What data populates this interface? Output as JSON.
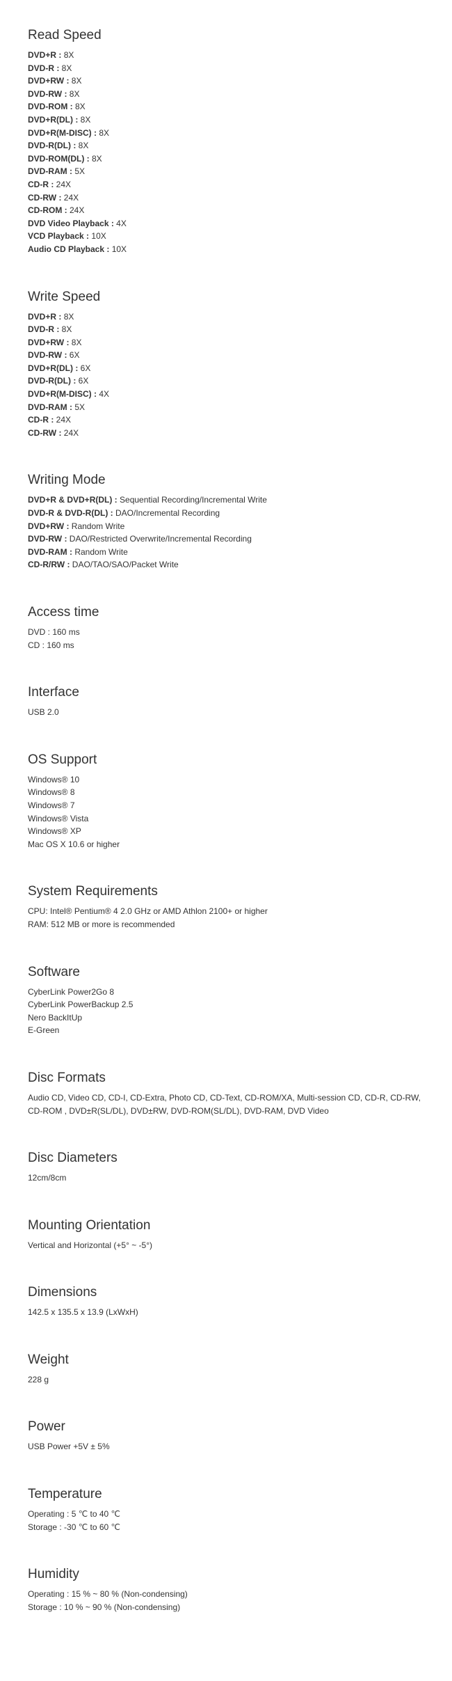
{
  "sections": [
    {
      "title": "Read Speed",
      "type": "labeled",
      "items": [
        {
          "label": "DVD+R",
          "value": "8X"
        },
        {
          "label": "DVD-R",
          "value": "8X"
        },
        {
          "label": "DVD+RW",
          "value": "8X"
        },
        {
          "label": "DVD-RW",
          "value": "8X"
        },
        {
          "label": "DVD-ROM",
          "value": "8X"
        },
        {
          "label": "DVD+R(DL)",
          "value": "8X"
        },
        {
          "label": "DVD+R(M-DISC)",
          "value": "8X"
        },
        {
          "label": "DVD-R(DL)",
          "value": "8X"
        },
        {
          "label": "DVD-ROM(DL)",
          "value": "8X"
        },
        {
          "label": "DVD-RAM",
          "value": "5X"
        },
        {
          "label": "CD-R",
          "value": "24X"
        },
        {
          "label": "CD-RW",
          "value": "24X"
        },
        {
          "label": "CD-ROM",
          "value": "24X"
        },
        {
          "label": "DVD Video Playback",
          "value": "4X"
        },
        {
          "label": "VCD Playback",
          "value": "10X"
        },
        {
          "label": "Audio CD Playback",
          "value": "10X"
        }
      ]
    },
    {
      "title": "Write Speed",
      "type": "labeled",
      "items": [
        {
          "label": "DVD+R",
          "value": "8X"
        },
        {
          "label": "DVD-R",
          "value": "8X"
        },
        {
          "label": "DVD+RW",
          "value": "8X"
        },
        {
          "label": "DVD-RW",
          "value": "6X"
        },
        {
          "label": "DVD+R(DL)",
          "value": "6X"
        },
        {
          "label": "DVD-R(DL)",
          "value": "6X"
        },
        {
          "label": "DVD+R(M-DISC)",
          "value": "4X"
        },
        {
          "label": "DVD-RAM",
          "value": "5X"
        },
        {
          "label": "CD-R",
          "value": "24X"
        },
        {
          "label": "CD-RW",
          "value": "24X"
        }
      ]
    },
    {
      "title": "Writing Mode",
      "type": "labeled",
      "items": [
        {
          "label": "DVD+R & DVD+R(DL)",
          "value": "Sequential Recording/Incremental Write"
        },
        {
          "label": "DVD-R & DVD-R(DL)",
          "value": "DAO/Incremental Recording"
        },
        {
          "label": "DVD+RW",
          "value": "Random Write"
        },
        {
          "label": "DVD-RW",
          "value": "DAO/Restricted Overwrite/Incremental Recording"
        },
        {
          "label": "DVD-RAM",
          "value": "Random Write"
        },
        {
          "label": "CD-R/RW",
          "value": "DAO/TAO/SAO/Packet Write"
        }
      ]
    },
    {
      "title": "Access time",
      "type": "plain",
      "lines": [
        "DVD : 160 ms",
        "CD : 160 ms"
      ]
    },
    {
      "title": "Interface",
      "type": "plain",
      "lines": [
        "USB 2.0"
      ]
    },
    {
      "title": "OS Support",
      "type": "plain",
      "lines": [
        "Windows® 10",
        "Windows® 8",
        "Windows® 7",
        "Windows® Vista",
        "Windows® XP",
        "Mac OS X 10.6 or higher"
      ]
    },
    {
      "title": "System Requirements",
      "type": "plain",
      "lines": [
        "CPU: Intel® Pentium® 4 2.0 GHz or AMD Athlon 2100+ or higher",
        "RAM: 512 MB or more is recommended"
      ]
    },
    {
      "title": "Software",
      "type": "plain",
      "lines": [
        "CyberLink Power2Go 8",
        "CyberLink PowerBackup 2.5",
        "Nero BackItUp",
        "E-Green"
      ]
    },
    {
      "title": "Disc Formats",
      "type": "plain",
      "lines": [
        "Audio CD, Video CD, CD-I, CD-Extra, Photo CD, CD-Text, CD-ROM/XA, Multi-session CD, CD-R, CD-RW, CD-ROM , DVD±R(SL/DL), DVD±RW, DVD-ROM(SL/DL), DVD-RAM, DVD Video"
      ]
    },
    {
      "title": "Disc Diameters",
      "type": "plain",
      "lines": [
        "12cm/8cm"
      ]
    },
    {
      "title": "Mounting Orientation",
      "type": "plain",
      "lines": [
        "Vertical and Horizontal (+5° ~ -5°)"
      ]
    },
    {
      "title": "Dimensions",
      "type": "plain",
      "lines": [
        "142.5 x 135.5 x 13.9 (LxWxH)"
      ]
    },
    {
      "title": "Weight",
      "type": "plain",
      "lines": [
        "228 g"
      ]
    },
    {
      "title": "Power",
      "type": "plain",
      "lines": [
        "USB Power +5V ± 5%"
      ]
    },
    {
      "title": "Temperature",
      "type": "plain",
      "lines": [
        "Operating : 5 ℃ to 40 ℃",
        "Storage : -30 ℃ to 60 ℃"
      ]
    },
    {
      "title": "Humidity",
      "type": "plain",
      "lines": [
        "Operating : 15 % ~ 80 % (Non-condensing)",
        "Storage : 10 % ~ 90 % (Non-condensing)"
      ]
    }
  ]
}
